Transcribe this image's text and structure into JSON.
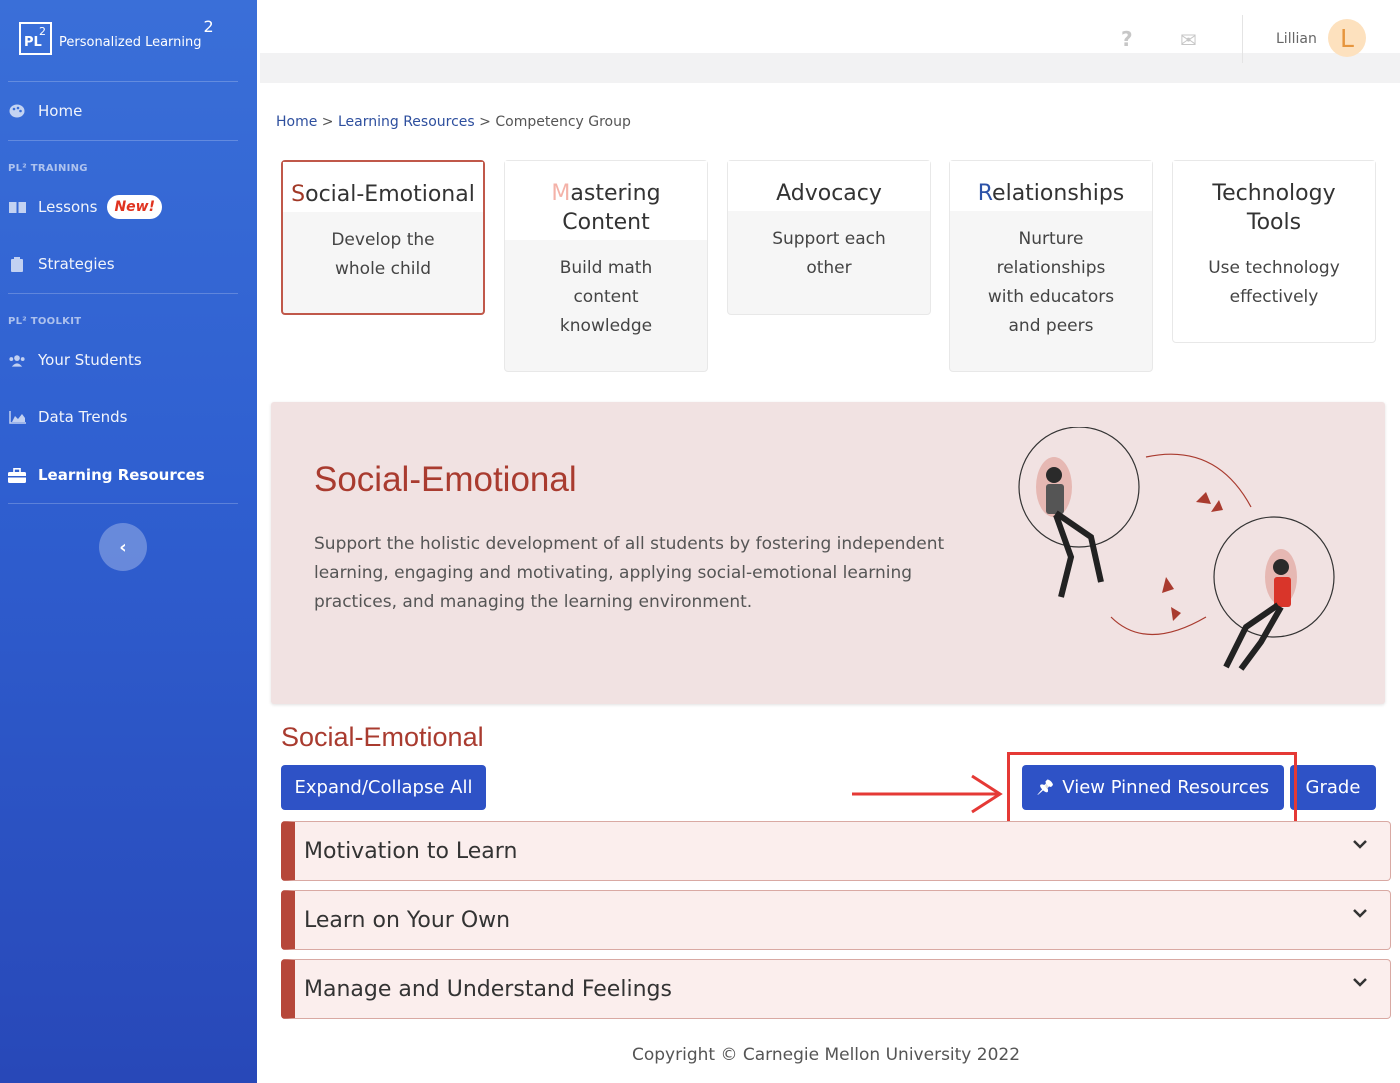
{
  "brand": {
    "logo_pl": "PL",
    "logo_sup": "2",
    "name": "Personalized Learning",
    "name_sup": "2"
  },
  "sidebar": {
    "home": "Home",
    "section_training": "PL² TRAINING",
    "lessons": "Lessons",
    "new_badge": "New!",
    "strategies": "Strategies",
    "section_toolkit": "PL² TOOLKIT",
    "your_students": "Your Students",
    "data_trends": "Data Trends",
    "learning_resources": "Learning Resources",
    "collapse_glyph": "‹"
  },
  "topbar": {
    "help_glyph": "?",
    "mail_glyph": "✉",
    "user_name": "Lillian",
    "avatar_initial": "L"
  },
  "breadcrumb": {
    "home": "Home",
    "sep": " > ",
    "learning_resources": "Learning Resources",
    "current": "Competency Group"
  },
  "cards": [
    {
      "first": "S",
      "rest": "ocial-Emotional",
      "desc": "Develop the whole child"
    },
    {
      "first": "M",
      "rest": "astering Content",
      "desc": "Build math content knowledge"
    },
    {
      "first": "A",
      "rest": "dvocacy",
      "desc": "Support each other"
    },
    {
      "first": "R",
      "rest": "elationships",
      "desc": "Nurture relationships with educators and peers"
    },
    {
      "first": "T",
      "rest": "echnology Tools",
      "desc": "Use technology effectively"
    }
  ],
  "hero": {
    "title": "Social-Emotional",
    "text": "Support the holistic development of all students by fostering independent learning, engaging and motivating, applying social-emotional learning practices, and managing the learning environment."
  },
  "section": {
    "title": "Social-Emotional",
    "expand_all": "Expand/Collapse All",
    "pin_glyph": "📌",
    "view_pinned": "View Pinned Resources",
    "grade": "Grade"
  },
  "accordion": [
    {
      "label": "Motivation to Learn"
    },
    {
      "label": "Learn on Your Own"
    },
    {
      "label": "Manage and Understand Feelings"
    }
  ],
  "footer": {
    "copyright": "Copyright © Carnegie Mellon University 2022"
  },
  "colors": {
    "accent_red": "#a93b2f",
    "primary_blue": "#2e52c6",
    "highlight_red": "#e53935"
  }
}
